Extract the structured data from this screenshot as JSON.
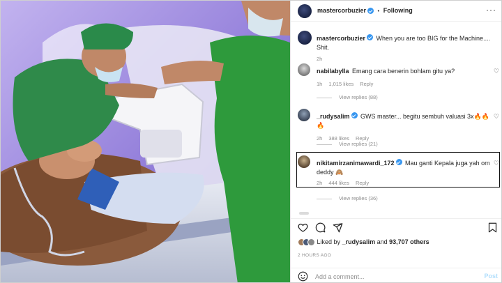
{
  "photo": {
    "description_icon": "photo-icon"
  },
  "header": {
    "username": "mastercorbuzier",
    "separator": "•",
    "follow_label": "Following"
  },
  "caption": {
    "username": "mastercorbuzier",
    "text": "When you are too BIG for the Machine.... Shit.",
    "time": "2h"
  },
  "comments": [
    {
      "username": "nabilabylla",
      "verified": false,
      "text": "Emang cara benerin bohlam gitu ya?",
      "time": "1h",
      "likes": "1,015 likes",
      "reply": "Reply",
      "view_replies": "View replies (88)"
    },
    {
      "username": "_rudysalim",
      "verified": true,
      "text": "GWS master... begitu sembuh valuasi 3x🔥🔥🔥",
      "time": "2h",
      "likes": "388 likes",
      "reply": "Reply",
      "view_replies": "View replies (21)"
    },
    {
      "username": "nikitamirzanimawardi_172",
      "verified": true,
      "text": "Mau ganti Kepala juga yah om deddy 🙈",
      "time": "2h",
      "likes": "444 likes",
      "reply": "Reply",
      "view_replies": "View replies (36)"
    }
  ],
  "liked": {
    "prefix": "Liked by",
    "user": "_rudysalim",
    "and": "and",
    "others": "93,707 others"
  },
  "ago": "2 HOURS AGO",
  "add_comment": {
    "placeholder": "Add a comment...",
    "post_label": "Post"
  },
  "colors": {
    "accent": "#3897f0",
    "post_disabled": "#b2dffc"
  }
}
